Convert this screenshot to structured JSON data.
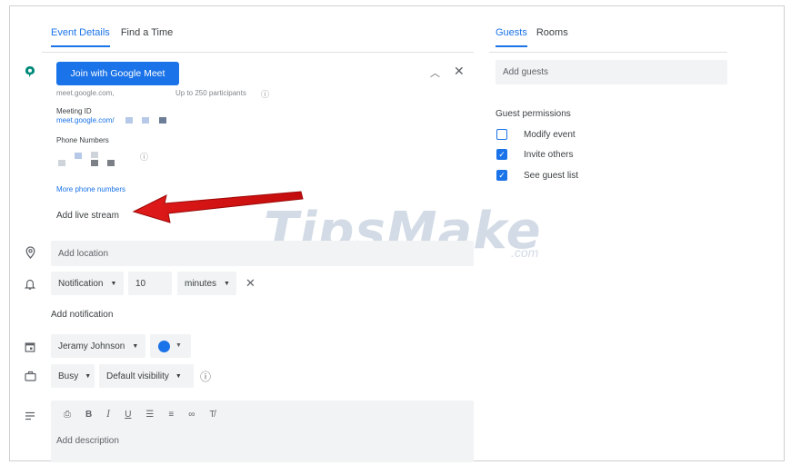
{
  "tabs": {
    "event_details": "Event Details",
    "find_time": "Find a Time"
  },
  "right_tabs": {
    "guests": "Guests",
    "rooms": "Rooms"
  },
  "meet": {
    "button": "Join with Google Meet",
    "url": "meet.google.com,",
    "participants": "Up to 250 participants",
    "meeting_id_label": "Meeting ID",
    "meeting_id_value": "meet.google.com/",
    "phone_label": "Phone Numbers",
    "more_phones": "More phone numbers",
    "live_stream": "Add live stream"
  },
  "location": {
    "placeholder": "Add location"
  },
  "notification": {
    "type": "Notification",
    "value": "10",
    "unit": "minutes",
    "add": "Add notification"
  },
  "calendar": {
    "owner": "Jeramy Johnson",
    "color": "#1a73e8"
  },
  "availability": {
    "status": "Busy",
    "visibility": "Default visibility"
  },
  "description": {
    "placeholder": "Add description"
  },
  "guests": {
    "placeholder": "Add guests"
  },
  "permissions": {
    "title": "Guest permissions",
    "items": [
      {
        "label": "Modify event",
        "checked": false
      },
      {
        "label": "Invite others",
        "checked": true
      },
      {
        "label": "See guest list",
        "checked": true
      }
    ]
  },
  "watermark": {
    "main": "TipsMake",
    "suffix": ".com"
  }
}
